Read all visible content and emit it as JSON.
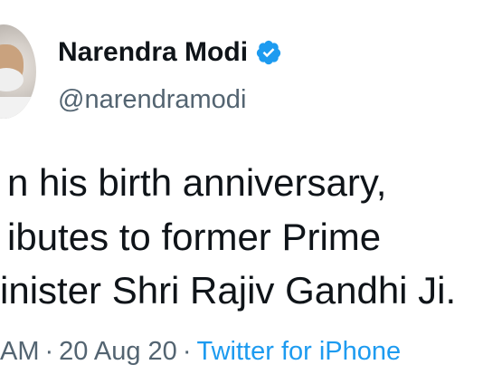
{
  "author": {
    "name": "Narendra Modi",
    "handle": "@narendramodi",
    "verified": true
  },
  "tweet": {
    "lines": [
      "n his birth anniversary,",
      "ibutes to former Prime",
      "inister Shri Rajiv Gandhi Ji."
    ]
  },
  "meta": {
    "time": "AM",
    "date": "20 Aug 20",
    "separator": "·",
    "source": "Twitter for iPhone"
  },
  "colors": {
    "verified_badge": "#1d9bf0",
    "link": "#1d9bf0",
    "muted": "#536471",
    "text": "#0f1419"
  }
}
